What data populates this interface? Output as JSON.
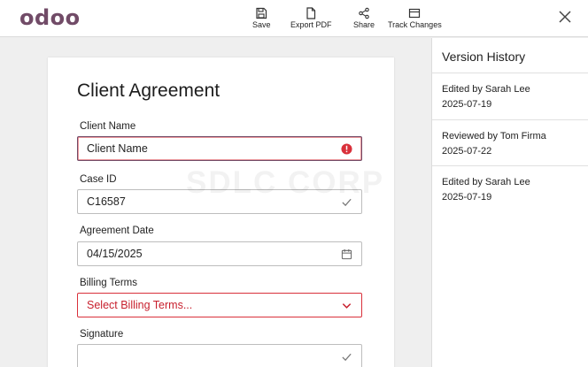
{
  "header": {
    "logo": "odoo",
    "toolbar": [
      {
        "label": "Save",
        "icon": "save-icon"
      },
      {
        "label": "Export PDF",
        "icon": "document-icon"
      },
      {
        "label": "Share",
        "icon": "share-icon"
      },
      {
        "label": "Track Changes",
        "icon": "track-changes-icon"
      }
    ],
    "close_icon": "close-icon"
  },
  "form": {
    "title": "Client Agreement",
    "fields": [
      {
        "label": "Client Name",
        "value": "Client Name",
        "state": "error",
        "icon": "error-icon"
      },
      {
        "label": "Case ID",
        "value": "C16587",
        "state": "valid",
        "icon": "check-icon"
      },
      {
        "label": "Agreement Date",
        "value": "04/15/2025",
        "state": "normal",
        "icon": "calendar-icon"
      },
      {
        "label": "Billing Terms",
        "value": "Select Billing Terms...",
        "state": "error",
        "icon": "chevron-down-icon"
      },
      {
        "label": "Signature",
        "value": "",
        "state": "valid",
        "icon": "check-icon"
      }
    ]
  },
  "watermark": "SDLC CORP",
  "version_history": {
    "title": "Version History",
    "items": [
      {
        "text": "Edited by Sarah Lee",
        "date": "2025-07-19"
      },
      {
        "text": "Reviewed by Tom Firma",
        "date": "2025-07-22"
      },
      {
        "text": "Edited by Sarah Lee",
        "date": "2025-07-19"
      }
    ]
  },
  "colors": {
    "brand": "#714b67",
    "error": "#d9303a",
    "border": "#bdbdbd"
  }
}
